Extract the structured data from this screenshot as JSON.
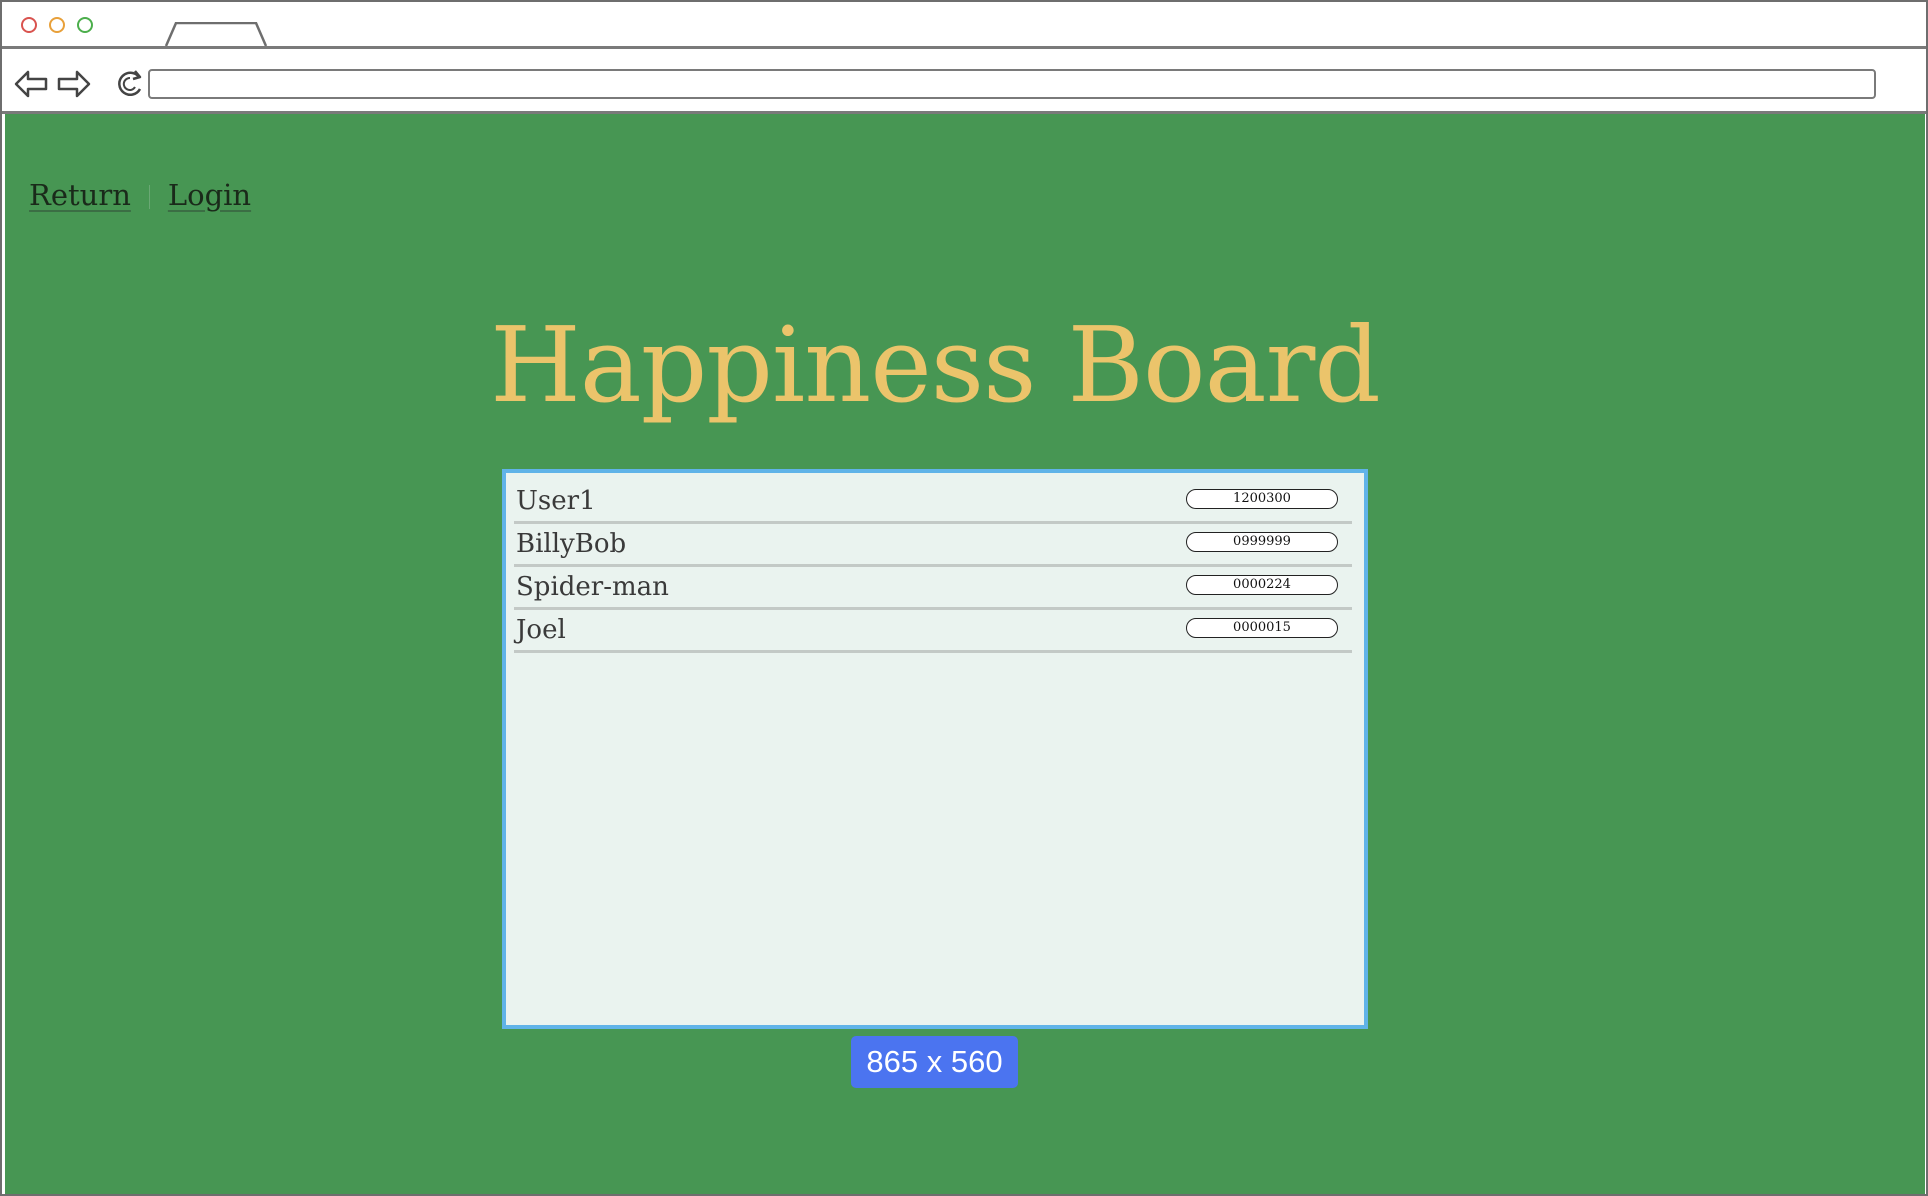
{
  "browser": {
    "address_bar": ""
  },
  "nav": {
    "return_label": "Return",
    "login_label": "Login"
  },
  "page": {
    "title": "Happiness Board",
    "size_badge": "865 x 560"
  },
  "board": {
    "rows": [
      {
        "name": "User1",
        "score": "1200300"
      },
      {
        "name": "BillyBob",
        "score": "0999999"
      },
      {
        "name": "Spider-man",
        "score": "0000224"
      },
      {
        "name": "Joel",
        "score": "0000015"
      }
    ]
  },
  "colors": {
    "page_background": "#479653",
    "title": "#ebc46b",
    "board_background": "#eaf3ef",
    "board_border": "#60b3e8",
    "badge": "#4b74f0"
  }
}
